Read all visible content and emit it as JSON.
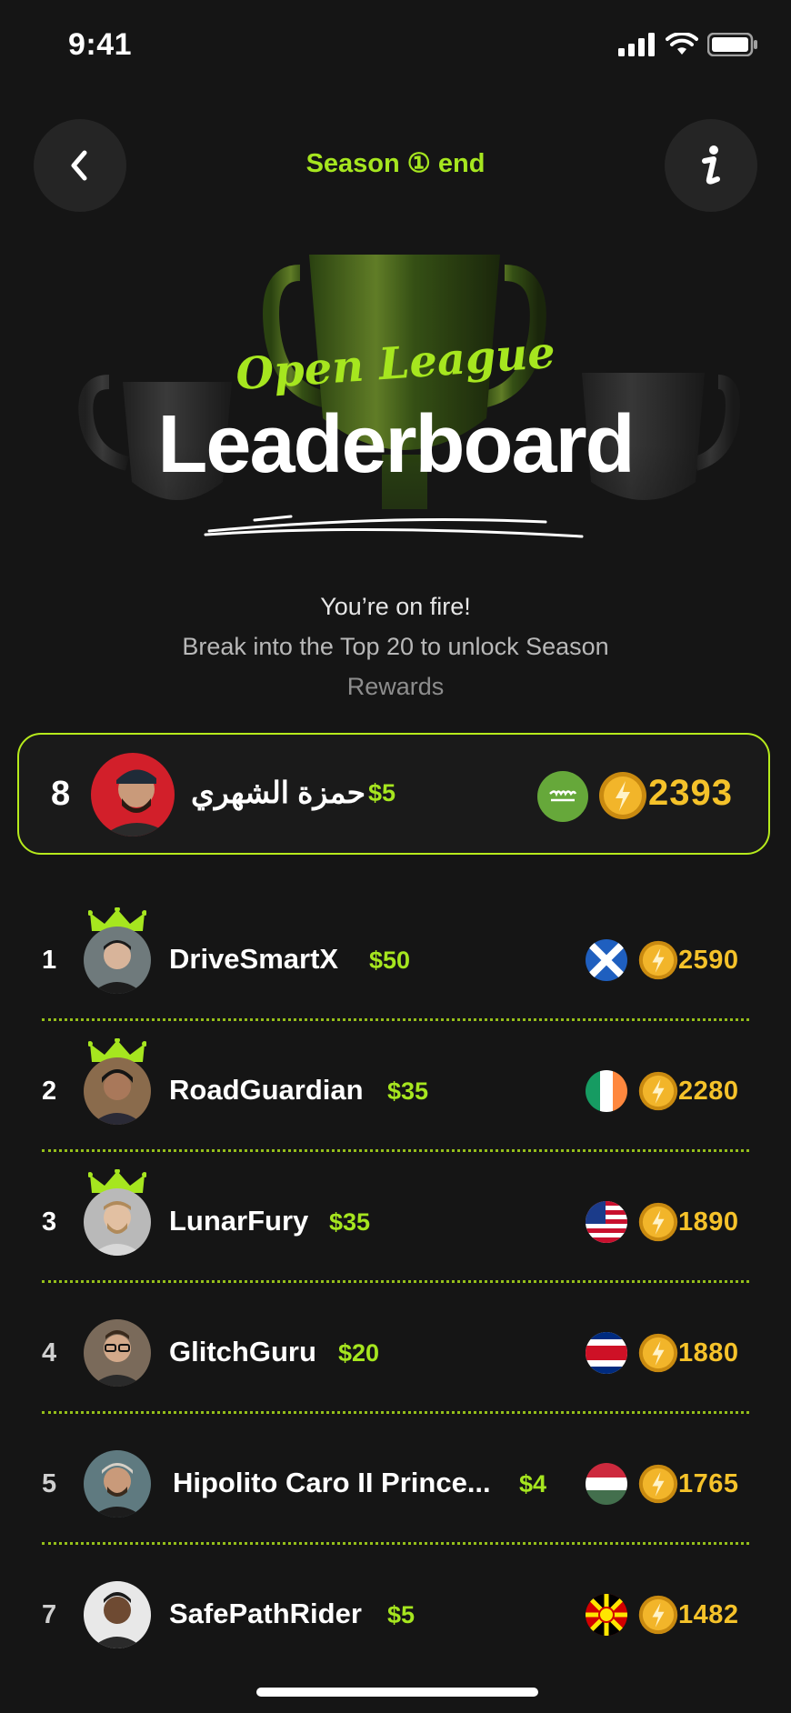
{
  "status_bar": {
    "time": "9:41"
  },
  "header": {
    "season": "Season ① end"
  },
  "hero": {
    "league": "Open League",
    "title": "Leaderboard",
    "line1": "You’re on fire!",
    "line2": "Break into the Top 20 to unlock Season",
    "line3": "Rewards"
  },
  "me": {
    "rank": "8",
    "name": "حمزة الشهري",
    "prize": "$5",
    "score": "2393",
    "flag_text": "﷽"
  },
  "rows": [
    {
      "rank": "1",
      "name": "DriveSmartX",
      "prize": "$50",
      "score": "2590",
      "flag": "scotland"
    },
    {
      "rank": "2",
      "name": "RoadGuardian",
      "prize": "$35",
      "score": "2280",
      "flag": "ireland"
    },
    {
      "rank": "3",
      "name": "LunarFury",
      "prize": "$35",
      "score": "1890",
      "flag": "usa"
    },
    {
      "rank": "4",
      "name": "GlitchGuru",
      "prize": "$20",
      "score": "1880",
      "flag": "costa-rica"
    },
    {
      "rank": "5",
      "name": "Hipolito Caro II Prince...",
      "prize": "$4",
      "score": "1765",
      "flag": "hungary"
    },
    {
      "rank": "7",
      "name": "SafePathRider",
      "prize": "$5",
      "score": "1482",
      "flag": "north-macedonia"
    }
  ],
  "colors": {
    "accent": "#a6e61f",
    "gold": "#f5c22a",
    "background": "#151515"
  }
}
